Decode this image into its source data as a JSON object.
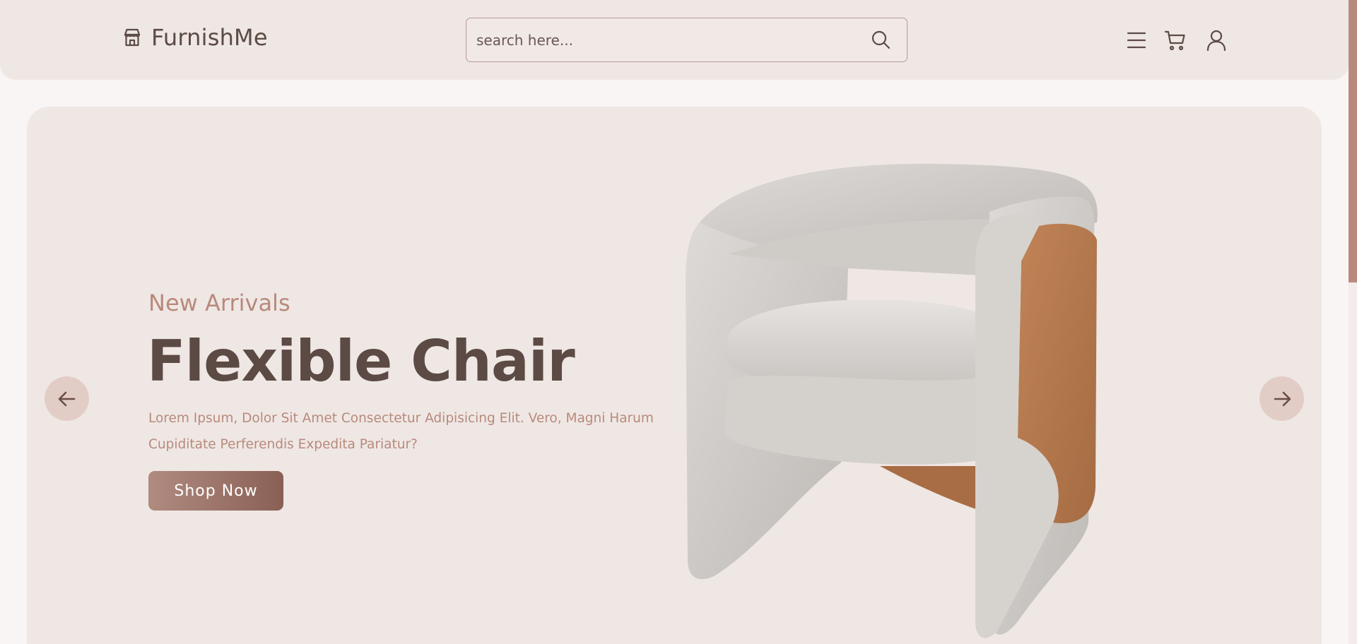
{
  "brand": {
    "name": "FurnishMe",
    "icon": "store-icon"
  },
  "search": {
    "placeholder": "search here...",
    "value": "",
    "icon": "search-icon"
  },
  "nav": {
    "icons": [
      "menu-icon",
      "cart-icon",
      "user-icon"
    ]
  },
  "hero": {
    "subtitle": "New Arrivals",
    "title": "Flexible Chair",
    "description": "Lorem Ipsum, Dolor Sit Amet Consectetur Adipisicing Elit. Vero, Magni Harum Cupiditate Perferendis Expedita Pariatur?",
    "button_label": "Shop Now",
    "image": "chair-image",
    "prev_icon": "arrow-left-icon",
    "next_icon": "arrow-right-icon"
  },
  "colors": {
    "primary_dark": "#5c4a44",
    "accent": "#b88a7c",
    "header_bg": "#efe7e4",
    "page_bg": "#f9f5f4",
    "arrow_bg": "#e2cdc6"
  }
}
